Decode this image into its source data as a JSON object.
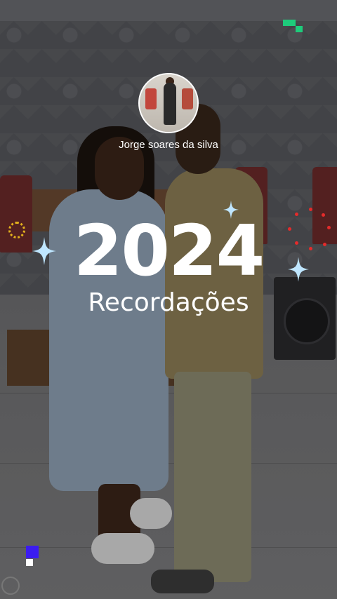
{
  "profile": {
    "name": "Jorge soares da silva"
  },
  "highlight": {
    "year": "2024",
    "title": "Recordações"
  },
  "colors": {
    "text": "#ffffff",
    "sparkle_blue": "#bfe6ff",
    "accent_green": "#1ecb7b",
    "accent_red": "#e52b2b",
    "accent_gold": "#e3b21d",
    "accent_purple": "#3b1cf0"
  },
  "icons": [
    "sparkle-icon",
    "camera-logo-icon"
  ]
}
